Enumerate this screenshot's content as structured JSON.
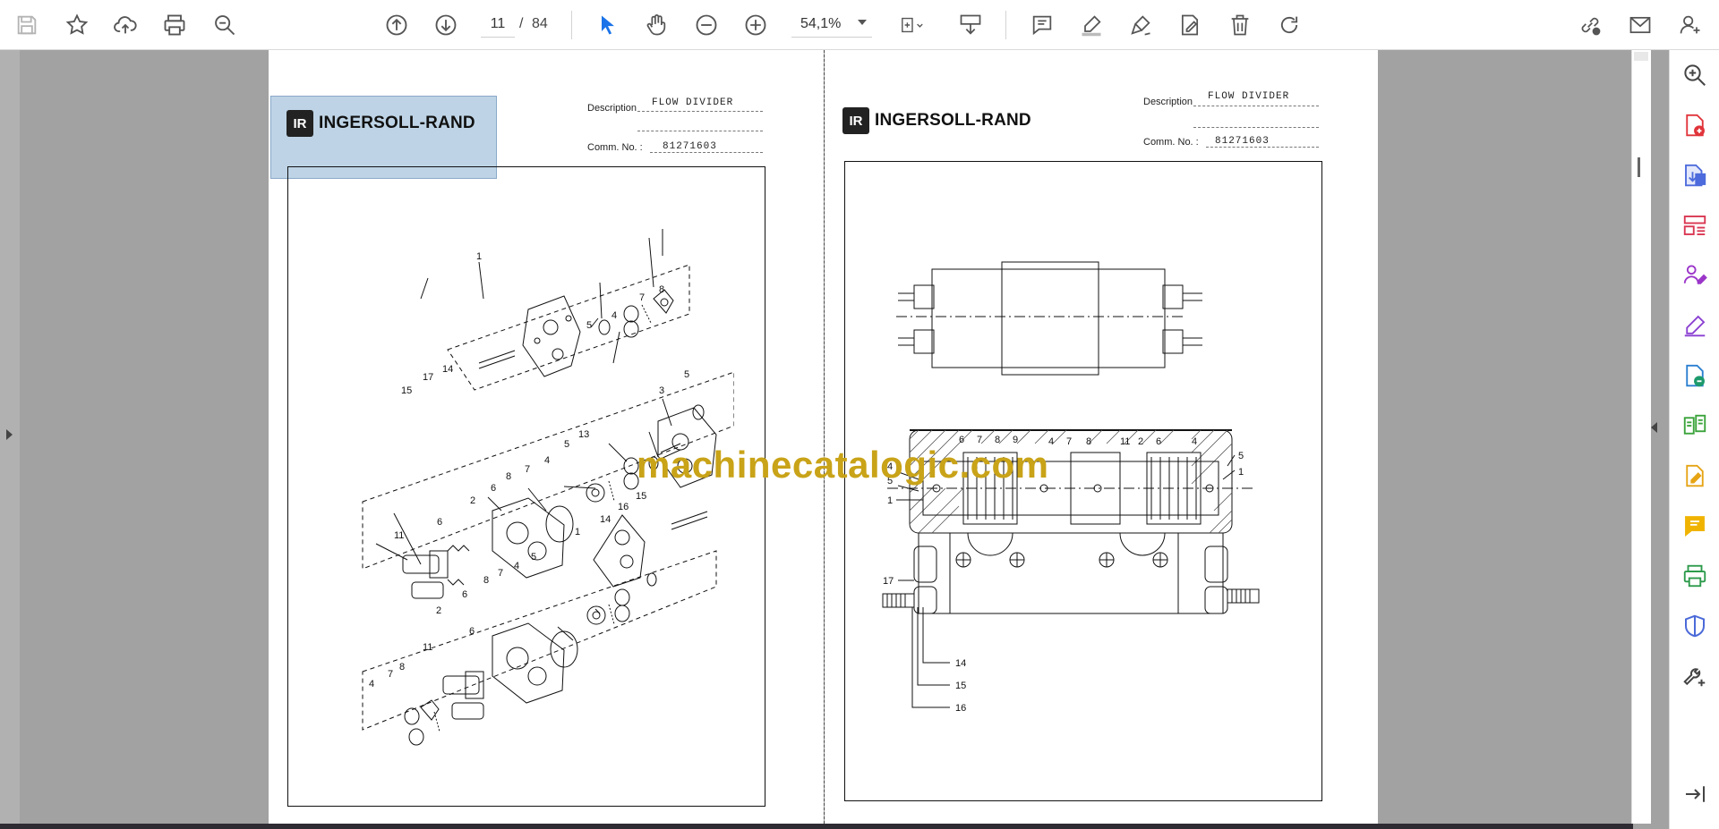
{
  "toolbar": {
    "current_page": "11",
    "page_separator": "/",
    "total_pages": "84",
    "zoom": "54,1%"
  },
  "document": {
    "watermark": "machinecatalogic.com",
    "left_page": {
      "brand": "INGERSOLL-RAND",
      "brand_mark": "IR",
      "description_label": "Description",
      "description_value": "FLOW DIVIDER",
      "comm_label": "Comm. No. :",
      "comm_value": "81271603",
      "callouts": [
        "1",
        "5",
        "4",
        "7",
        "8",
        "15",
        "17",
        "14",
        "5",
        "3",
        "13",
        "5",
        "4",
        "7",
        "8",
        "6",
        "2",
        "11",
        "6",
        "16",
        "15",
        "14",
        "1",
        "5",
        "4",
        "7",
        "8",
        "6",
        "2",
        "11",
        "6",
        "4",
        "7",
        "8"
      ]
    },
    "right_page": {
      "brand": "INGERSOLL-RAND",
      "brand_mark": "IR",
      "description_label": "Description",
      "description_value": "FLOW DIVIDER",
      "comm_label": "Comm. No. :",
      "comm_value": "81271603",
      "callouts": [
        "4",
        "5",
        "1",
        "6",
        "7",
        "8",
        "9",
        "4",
        "7",
        "8",
        "11",
        "2",
        "6",
        "4",
        "5",
        "1",
        "17",
        "14",
        "15",
        "16"
      ]
    }
  },
  "colors": {
    "watermark": "#c9a318",
    "viewer_background": "#a2a2a2",
    "selection_highlight": "#6ea0c8",
    "accent_blue": "#1a73e8"
  },
  "icons": {
    "toolbar": [
      "save-icon",
      "bookmark-star-icon",
      "upload-cloud-icon",
      "print-icon",
      "zoom-search-icon",
      "page-up-icon",
      "page-down-icon",
      "select-cursor-icon",
      "hand-tool-icon",
      "zoom-out-icon",
      "zoom-in-icon",
      "fit-page-icon",
      "scroll-mode-icon",
      "comment-icon",
      "highlight-pen-icon",
      "draw-icon",
      "sign-edit-icon",
      "delete-icon",
      "rotate-icon",
      "share-link-icon",
      "email-icon",
      "account-icon"
    ],
    "rail": [
      "search-tool-icon",
      "create-pdf-icon",
      "export-pdf-icon",
      "organize-pages-icon",
      "request-signature-icon",
      "fill-sign-icon",
      "convert-pdf-icon",
      "compare-icon",
      "edit-pdf-icon",
      "comment-tool-icon",
      "print-production-icon",
      "protect-icon",
      "more-tools-icon",
      "expand-panel-icon"
    ]
  }
}
